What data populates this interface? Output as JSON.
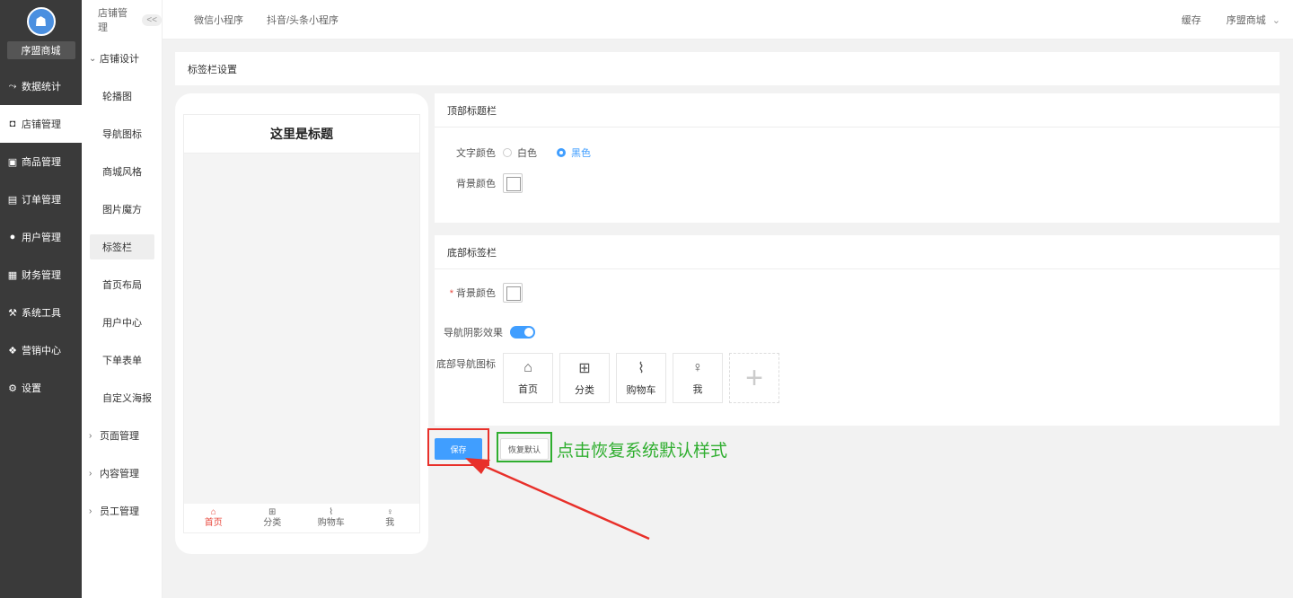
{
  "sidebar": {
    "logo_name": "序盟商城",
    "items": [
      {
        "icon": "chart-icon",
        "glyph": "⤳",
        "label": "数据统计",
        "active": false
      },
      {
        "icon": "store-icon",
        "glyph": "◘",
        "label": "店铺管理",
        "active": true
      },
      {
        "icon": "goods-icon",
        "glyph": "▣",
        "label": "商品管理",
        "active": false
      },
      {
        "icon": "order-icon",
        "glyph": "▤",
        "label": "订单管理",
        "active": false
      },
      {
        "icon": "user-icon",
        "glyph": "●",
        "label": "用户管理",
        "active": false
      },
      {
        "icon": "finance-icon",
        "glyph": "▦",
        "label": "财务管理",
        "active": false
      },
      {
        "icon": "wrench-icon",
        "glyph": "⚒",
        "label": "系统工具",
        "active": false
      },
      {
        "icon": "marketing-icon",
        "glyph": "❖",
        "label": "营销中心",
        "active": false
      },
      {
        "icon": "gear-icon",
        "glyph": "⚙",
        "label": "设置",
        "active": false
      }
    ]
  },
  "subnav": {
    "header": "店铺管理",
    "collapse": "<<",
    "design_group": "店铺设计",
    "design_items": [
      "轮播图",
      "导航图标",
      "商城风格",
      "图片魔方",
      "标签栏",
      "首页布局",
      "用户中心",
      "下单表单",
      "自定义海报"
    ],
    "active_item": "标签栏",
    "other_groups": [
      "页面管理",
      "内容管理",
      "员工管理"
    ]
  },
  "topbar": {
    "tabs": [
      "微信小程序",
      "抖音/头条小程序"
    ],
    "cache": "缓存",
    "shop": "序盟商城"
  },
  "page": {
    "title": "标签栏设置"
  },
  "phone": {
    "title": "这里是标题",
    "tabs": [
      {
        "icon": "home-icon",
        "glyph": "⌂",
        "label": "首页",
        "on": true
      },
      {
        "icon": "category-icon",
        "glyph": "⊞",
        "label": "分类",
        "on": false
      },
      {
        "icon": "cart-icon",
        "glyph": "⌇",
        "label": "购物车",
        "on": false
      },
      {
        "icon": "person-icon",
        "glyph": "♀",
        "label": "我",
        "on": false
      }
    ]
  },
  "top_bar_card": {
    "title": "顶部标题栏",
    "text_color_label": "文字颜色",
    "white": "白色",
    "black": "黑色",
    "bg_label": "背景颜色"
  },
  "bottom_bar_card": {
    "title": "底部标签栏",
    "required_mark": "*",
    "bg_label": "背景颜色",
    "shadow_label": "导航阴影效果",
    "icons_label": "底部导航图标",
    "nav_items": [
      {
        "icon": "home-icon",
        "glyph": "⌂",
        "label": "首页"
      },
      {
        "icon": "category-icon",
        "glyph": "⊞",
        "label": "分类"
      },
      {
        "icon": "cart-icon",
        "glyph": "⌇",
        "label": "购物车"
      },
      {
        "icon": "person-icon",
        "glyph": "♀",
        "label": "我"
      }
    ],
    "add_glyph": "+"
  },
  "actions": {
    "save": "保存",
    "reset": "恢复默认"
  },
  "annotation": "点击恢复系统默认样式",
  "colors": {
    "accent": "#409eff",
    "sidebar": "#3a3a3a",
    "highlight_red": "#e8302a",
    "highlight_green": "#2fae2f",
    "tab_active": "#e84a3f"
  }
}
